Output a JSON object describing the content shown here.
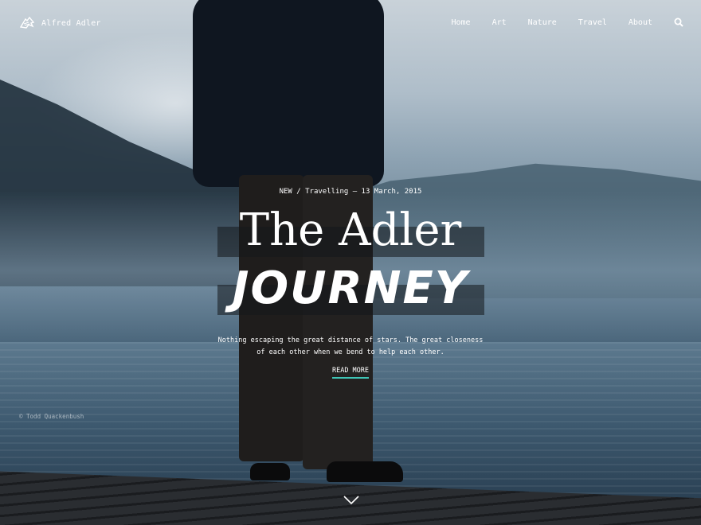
{
  "header": {
    "brand_name": "Alfred Adler",
    "logo_icon": "zebra-logo-icon",
    "menu": [
      {
        "label": "Home"
      },
      {
        "label": "Art"
      },
      {
        "label": "Nature"
      },
      {
        "label": "Travel"
      },
      {
        "label": "About"
      }
    ],
    "search_icon": "search-icon"
  },
  "hero": {
    "meta": "NEW / Travelling – 13 March, 2015",
    "title_line1": "The Adler",
    "title_line2": "JOURNEY",
    "excerpt": "Nothing escaping the great distance of stars. The great closeness of each other when we bend to help each other.",
    "read_more": "READ MORE",
    "photo_credit": "© Todd Quackenbush",
    "scroll_icon": "chevron-down-icon"
  },
  "colors": {
    "accent": "#3fc4b5",
    "text": "#ffffff",
    "title_band": "#14181c"
  }
}
